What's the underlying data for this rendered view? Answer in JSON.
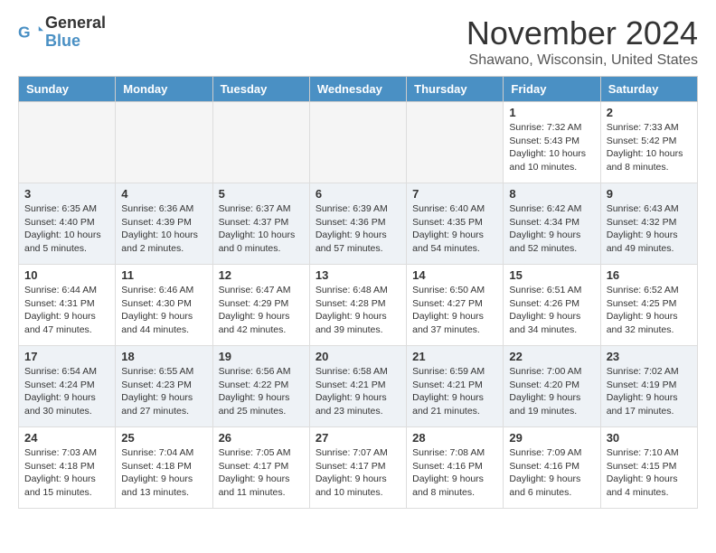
{
  "header": {
    "logo_line1": "General",
    "logo_line2": "Blue",
    "month": "November 2024",
    "location": "Shawano, Wisconsin, United States"
  },
  "weekdays": [
    "Sunday",
    "Monday",
    "Tuesday",
    "Wednesday",
    "Thursday",
    "Friday",
    "Saturday"
  ],
  "weeks": [
    [
      {
        "day": "",
        "info": ""
      },
      {
        "day": "",
        "info": ""
      },
      {
        "day": "",
        "info": ""
      },
      {
        "day": "",
        "info": ""
      },
      {
        "day": "",
        "info": ""
      },
      {
        "day": "1",
        "info": "Sunrise: 7:32 AM\nSunset: 5:43 PM\nDaylight: 10 hours and 10 minutes."
      },
      {
        "day": "2",
        "info": "Sunrise: 7:33 AM\nSunset: 5:42 PM\nDaylight: 10 hours and 8 minutes."
      }
    ],
    [
      {
        "day": "3",
        "info": "Sunrise: 6:35 AM\nSunset: 4:40 PM\nDaylight: 10 hours and 5 minutes."
      },
      {
        "day": "4",
        "info": "Sunrise: 6:36 AM\nSunset: 4:39 PM\nDaylight: 10 hours and 2 minutes."
      },
      {
        "day": "5",
        "info": "Sunrise: 6:37 AM\nSunset: 4:37 PM\nDaylight: 10 hours and 0 minutes."
      },
      {
        "day": "6",
        "info": "Sunrise: 6:39 AM\nSunset: 4:36 PM\nDaylight: 9 hours and 57 minutes."
      },
      {
        "day": "7",
        "info": "Sunrise: 6:40 AM\nSunset: 4:35 PM\nDaylight: 9 hours and 54 minutes."
      },
      {
        "day": "8",
        "info": "Sunrise: 6:42 AM\nSunset: 4:34 PM\nDaylight: 9 hours and 52 minutes."
      },
      {
        "day": "9",
        "info": "Sunrise: 6:43 AM\nSunset: 4:32 PM\nDaylight: 9 hours and 49 minutes."
      }
    ],
    [
      {
        "day": "10",
        "info": "Sunrise: 6:44 AM\nSunset: 4:31 PM\nDaylight: 9 hours and 47 minutes."
      },
      {
        "day": "11",
        "info": "Sunrise: 6:46 AM\nSunset: 4:30 PM\nDaylight: 9 hours and 44 minutes."
      },
      {
        "day": "12",
        "info": "Sunrise: 6:47 AM\nSunset: 4:29 PM\nDaylight: 9 hours and 42 minutes."
      },
      {
        "day": "13",
        "info": "Sunrise: 6:48 AM\nSunset: 4:28 PM\nDaylight: 9 hours and 39 minutes."
      },
      {
        "day": "14",
        "info": "Sunrise: 6:50 AM\nSunset: 4:27 PM\nDaylight: 9 hours and 37 minutes."
      },
      {
        "day": "15",
        "info": "Sunrise: 6:51 AM\nSunset: 4:26 PM\nDaylight: 9 hours and 34 minutes."
      },
      {
        "day": "16",
        "info": "Sunrise: 6:52 AM\nSunset: 4:25 PM\nDaylight: 9 hours and 32 minutes."
      }
    ],
    [
      {
        "day": "17",
        "info": "Sunrise: 6:54 AM\nSunset: 4:24 PM\nDaylight: 9 hours and 30 minutes."
      },
      {
        "day": "18",
        "info": "Sunrise: 6:55 AM\nSunset: 4:23 PM\nDaylight: 9 hours and 27 minutes."
      },
      {
        "day": "19",
        "info": "Sunrise: 6:56 AM\nSunset: 4:22 PM\nDaylight: 9 hours and 25 minutes."
      },
      {
        "day": "20",
        "info": "Sunrise: 6:58 AM\nSunset: 4:21 PM\nDaylight: 9 hours and 23 minutes."
      },
      {
        "day": "21",
        "info": "Sunrise: 6:59 AM\nSunset: 4:21 PM\nDaylight: 9 hours and 21 minutes."
      },
      {
        "day": "22",
        "info": "Sunrise: 7:00 AM\nSunset: 4:20 PM\nDaylight: 9 hours and 19 minutes."
      },
      {
        "day": "23",
        "info": "Sunrise: 7:02 AM\nSunset: 4:19 PM\nDaylight: 9 hours and 17 minutes."
      }
    ],
    [
      {
        "day": "24",
        "info": "Sunrise: 7:03 AM\nSunset: 4:18 PM\nDaylight: 9 hours and 15 minutes."
      },
      {
        "day": "25",
        "info": "Sunrise: 7:04 AM\nSunset: 4:18 PM\nDaylight: 9 hours and 13 minutes."
      },
      {
        "day": "26",
        "info": "Sunrise: 7:05 AM\nSunset: 4:17 PM\nDaylight: 9 hours and 11 minutes."
      },
      {
        "day": "27",
        "info": "Sunrise: 7:07 AM\nSunset: 4:17 PM\nDaylight: 9 hours and 10 minutes."
      },
      {
        "day": "28",
        "info": "Sunrise: 7:08 AM\nSunset: 4:16 PM\nDaylight: 9 hours and 8 minutes."
      },
      {
        "day": "29",
        "info": "Sunrise: 7:09 AM\nSunset: 4:16 PM\nDaylight: 9 hours and 6 minutes."
      },
      {
        "day": "30",
        "info": "Sunrise: 7:10 AM\nSunset: 4:15 PM\nDaylight: 9 hours and 4 minutes."
      }
    ]
  ]
}
